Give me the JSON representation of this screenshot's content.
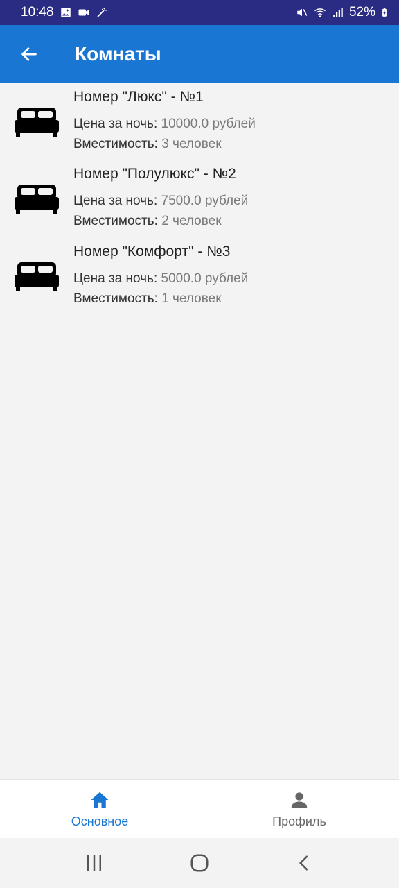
{
  "status_bar": {
    "time": "10:48",
    "battery": "52%",
    "icons": [
      "image-icon",
      "video-camera-icon",
      "magic-wand-icon",
      "mute-icon",
      "wifi-icon",
      "signal-icon",
      "battery-charging-icon"
    ]
  },
  "app_bar": {
    "title": "Комнаты",
    "back_icon": "arrow-back-icon",
    "background_color": "#1976d2"
  },
  "rooms": [
    {
      "name": "Номер \"Люкс\" - №1",
      "price_label": "Цена за ночь:",
      "price": "10000.0 рублей",
      "capacity_label": "Вместимость:",
      "capacity": "3 человек",
      "icon": "bed-icon"
    },
    {
      "name": "Номер \"Полулюкс\" - №2",
      "price_label": "Цена за ночь:",
      "price": "7500.0 рублей",
      "capacity_label": "Вместимость:",
      "capacity": "2 человек",
      "icon": "bed-icon"
    },
    {
      "name": "Номер \"Комфорт\" - №3",
      "price_label": "Цена за ночь:",
      "price": "5000.0 рублей",
      "capacity_label": "Вместимость:",
      "capacity": "1 человек",
      "icon": "bed-icon"
    }
  ],
  "bottom_nav": {
    "items": [
      {
        "label": "Основное",
        "icon": "home-icon",
        "active": true
      },
      {
        "label": "Профиль",
        "icon": "person-icon",
        "active": false
      }
    ],
    "active_color": "#1976d2"
  },
  "system_nav": {
    "buttons": [
      "recent-apps-icon",
      "home-circle-icon",
      "back-chevron-icon"
    ]
  }
}
